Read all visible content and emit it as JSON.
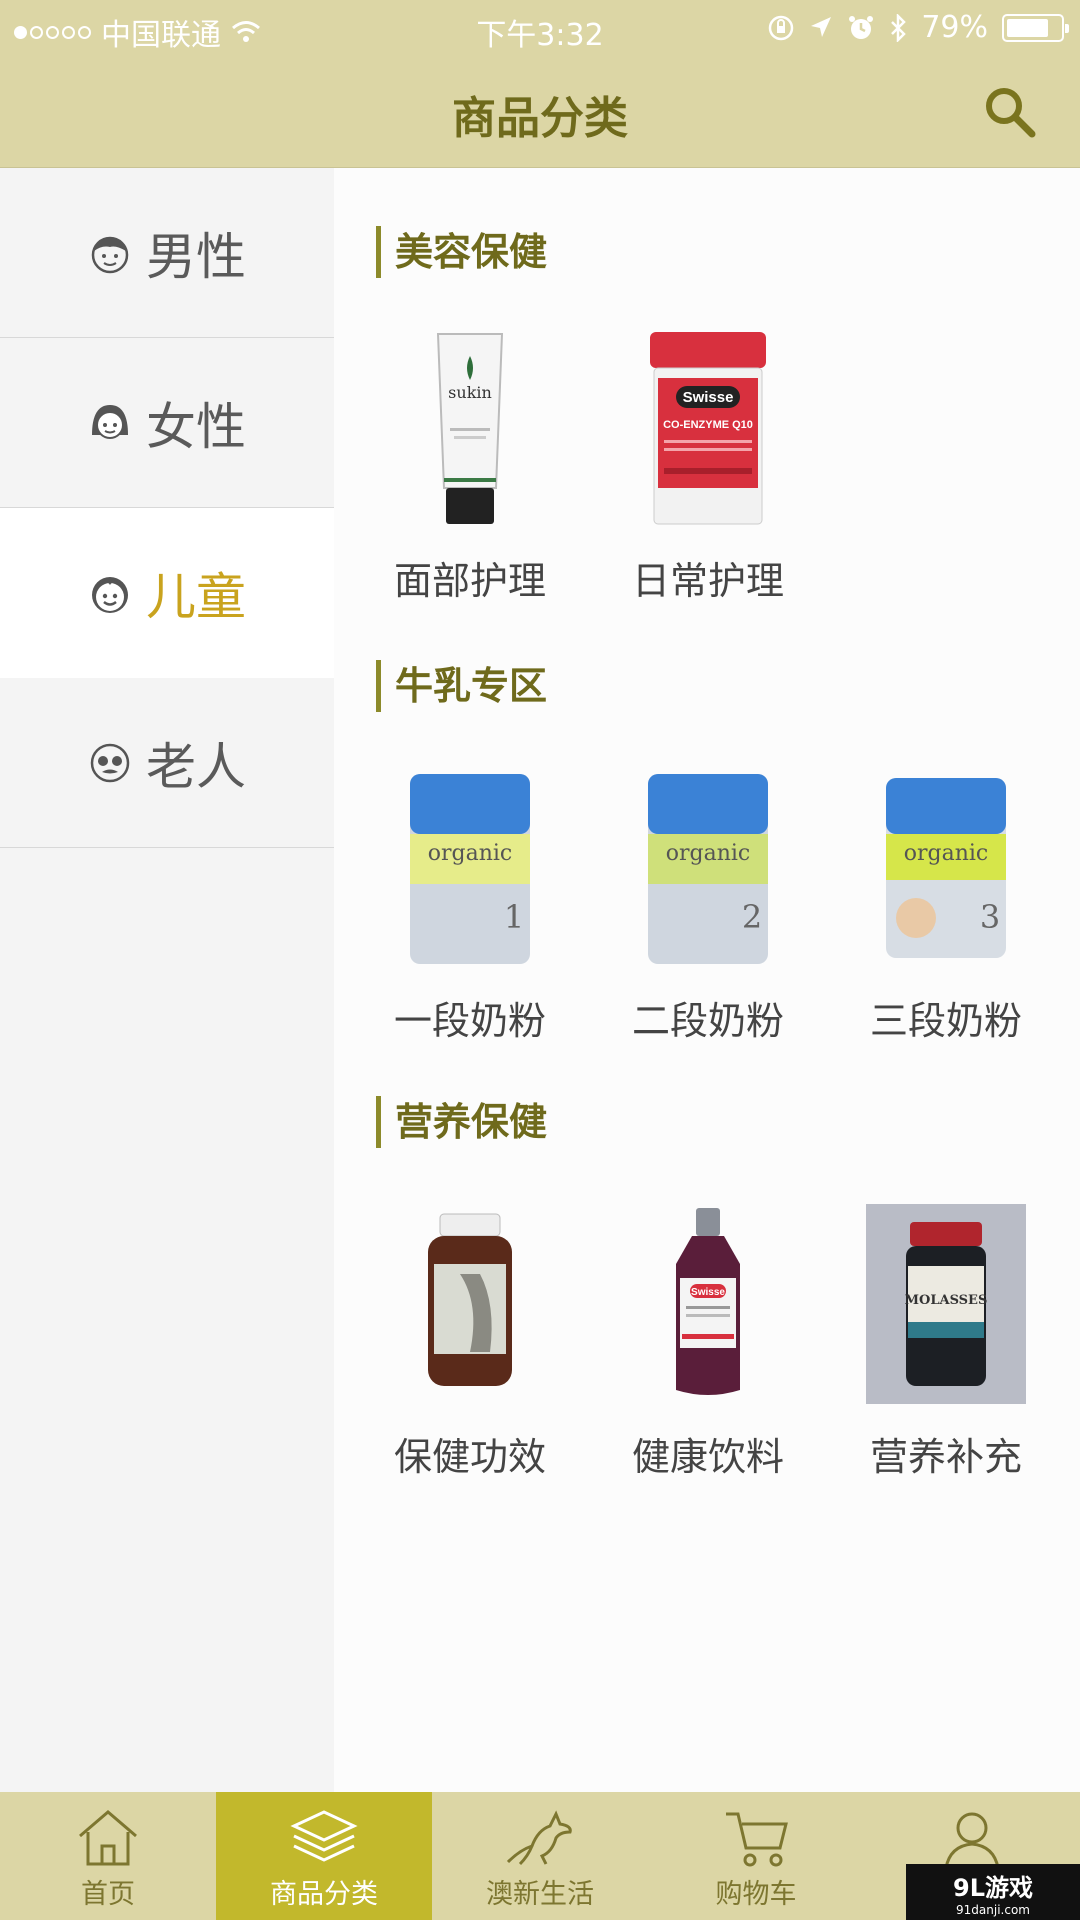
{
  "status_bar": {
    "carrier": "中国联通",
    "time": "下午3:32",
    "battery_percent": "79%",
    "battery_level": 0.79
  },
  "header": {
    "title": "商品分类"
  },
  "sidebar": {
    "items": [
      {
        "label": "男性",
        "icon": "man-face-icon"
      },
      {
        "label": "女性",
        "icon": "woman-face-icon"
      },
      {
        "label": "儿童",
        "icon": "child-face-icon",
        "active": true
      },
      {
        "label": "老人",
        "icon": "elder-face-icon"
      }
    ]
  },
  "sections": [
    {
      "title": "美容保健",
      "items": [
        {
          "label": "面部护理",
          "image": "facial-scrub-tube",
          "image_text": "sukin"
        },
        {
          "label": "日常护理",
          "image": "coenzyme-bottle",
          "image_text": "Swisse",
          "image_subtext": "CO-ENZYME Q10"
        }
      ]
    },
    {
      "title": "牛乳专区",
      "items": [
        {
          "label": "一段奶粉",
          "image": "formula-can-1",
          "image_text": "organic",
          "image_num": "1"
        },
        {
          "label": "二段奶粉",
          "image": "formula-can-2",
          "image_text": "organic",
          "image_num": "2"
        },
        {
          "label": "三段奶粉",
          "image": "formula-can-3",
          "image_text": "organic",
          "image_num": "3"
        }
      ]
    },
    {
      "title": "营养保健",
      "items": [
        {
          "label": "保健功效",
          "image": "supplement-jar"
        },
        {
          "label": "健康饮料",
          "image": "swisse-drink-bottle",
          "image_text": "Swisse"
        },
        {
          "label": "营养补充",
          "image": "molasses-jar",
          "image_text": "MOLASSES"
        }
      ]
    }
  ],
  "tabbar": {
    "items": [
      {
        "label": "首页",
        "icon": "home-icon"
      },
      {
        "label": "商品分类",
        "icon": "layers-icon",
        "active": true
      },
      {
        "label": "澳新生活",
        "icon": "kangaroo-icon"
      },
      {
        "label": "购物车",
        "icon": "cart-icon"
      },
      {
        "label": "",
        "icon": "user-icon"
      }
    ]
  },
  "watermark": {
    "title": "9L游戏",
    "sub": "91danji.com"
  },
  "colors": {
    "header": "#dcd6a5",
    "accent": "#c9a31e",
    "tab_active": "#c2b82c",
    "title": "#6f6a1c"
  }
}
